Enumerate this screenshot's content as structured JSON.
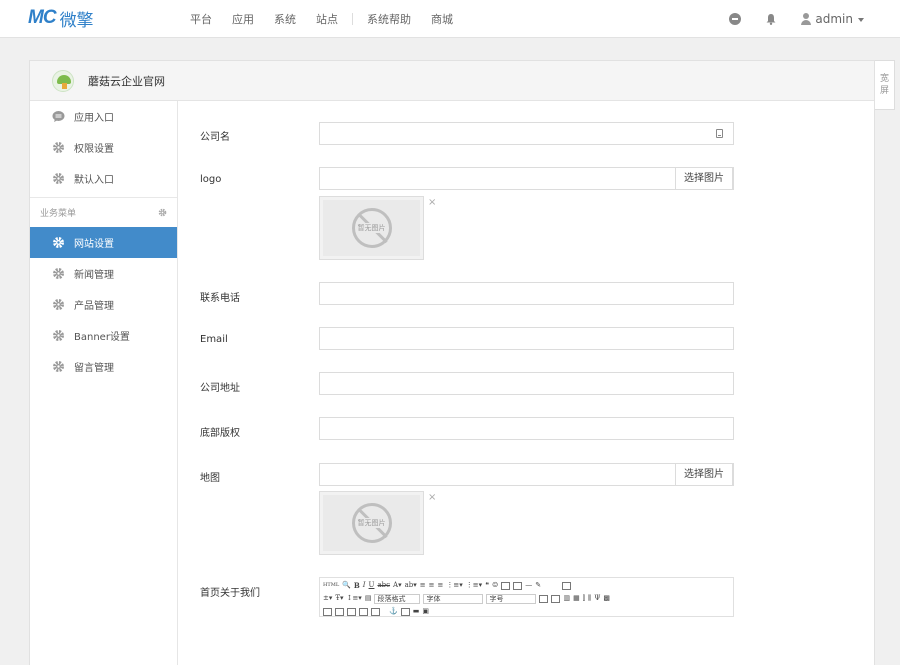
{
  "brand": {
    "mark": "MC",
    "name": "微擎"
  },
  "nav": [
    {
      "label": "平台"
    },
    {
      "label": "应用"
    },
    {
      "label": "系统"
    },
    {
      "label": "站点"
    },
    {
      "label": "系统帮助"
    },
    {
      "label": "商城"
    }
  ],
  "user": {
    "name": "admin"
  },
  "site": {
    "name": "蘑菇云企业官网"
  },
  "sidebar": {
    "items": [
      {
        "label": "应用入口"
      },
      {
        "label": "权限设置"
      },
      {
        "label": "默认入口"
      }
    ],
    "group_title": "业务菜单",
    "business": [
      {
        "label": "网站设置",
        "active": true
      },
      {
        "label": "新闻管理"
      },
      {
        "label": "产品管理"
      },
      {
        "label": "Banner设置"
      },
      {
        "label": "留言管理"
      }
    ]
  },
  "form": {
    "company_name_label": "公司名",
    "logo_label": "logo",
    "select_image": "选择图片",
    "no_image": "暂无图片",
    "phone_label": "联系电话",
    "email_label": "Email",
    "address_label": "公司地址",
    "copyright_label": "底部版权",
    "map_label": "地图",
    "about_label": "首页关于我们"
  },
  "editor": {
    "html_label": "HTML",
    "paragraph_format": "段落格式",
    "font_family": "字体",
    "font_size": "字号"
  },
  "wide_screen": {
    "line1": "宽",
    "line2": "屏"
  },
  "colors": {
    "accent": "#428bca",
    "brand": "#2f80c9"
  }
}
